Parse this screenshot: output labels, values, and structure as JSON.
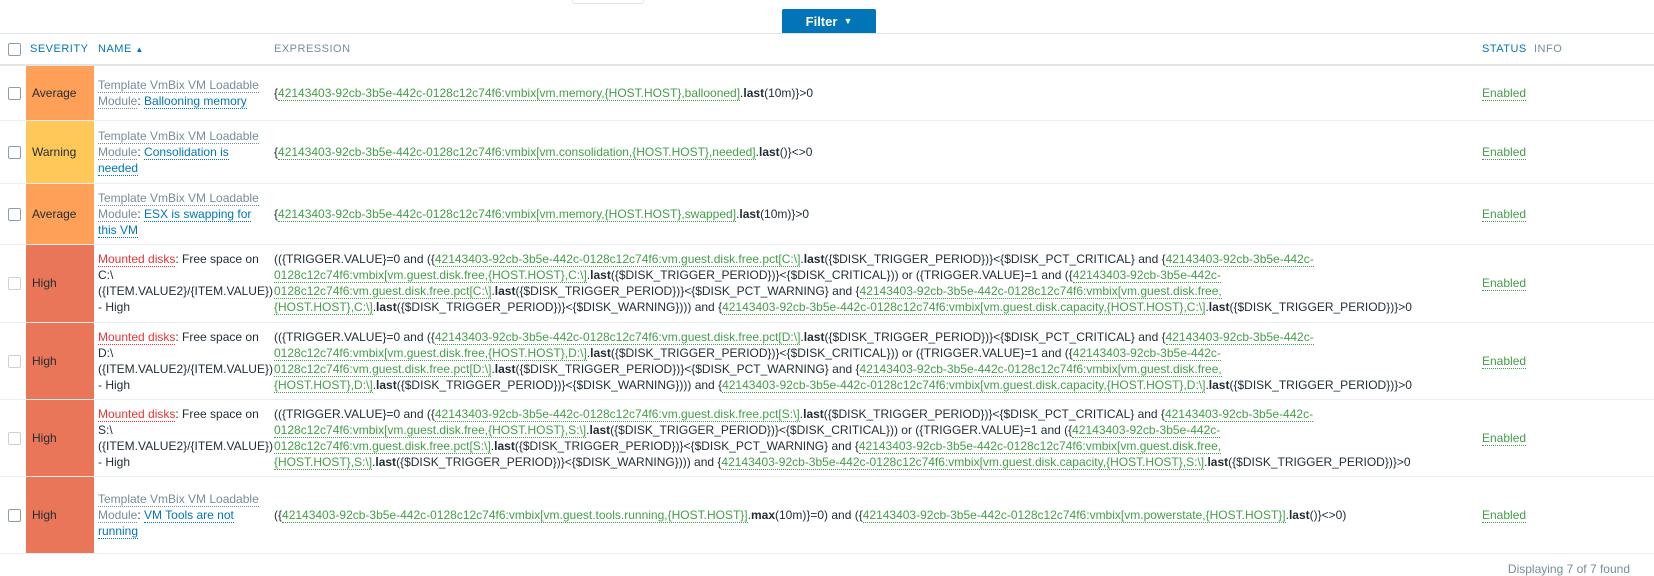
{
  "filter": {
    "label": "Filter",
    "caret": "▼"
  },
  "columns": {
    "severity": "SEVERITY",
    "name": "NAME",
    "sort_arrow": "▲",
    "expression": "EXPRESSION",
    "status": "STATUS",
    "info": "INFO"
  },
  "colors": {
    "average": "#ffa059",
    "warning": "#ffc859",
    "high": "#e97659",
    "link": "#0275b8",
    "enabled": "#429e47"
  },
  "rows": [
    {
      "severity": "Average",
      "template": "Template VmBix VM Loadable Module",
      "name": "Ballooning memory",
      "expression": [
        {
          "t": "{"
        },
        {
          "t": "42143403-92cb-3b5e-442c-0128c12c74f6:vmbix[vm.memory,{HOST.HOST},ballooned]",
          "c": "g"
        },
        {
          "t": "."
        },
        {
          "t": "last",
          "c": "f"
        },
        {
          "t": "(10m)}>0"
        }
      ],
      "status": "Enabled"
    },
    {
      "severity": "Warning",
      "template": "Template VmBix VM Loadable Module",
      "name": "Consolidation is needed",
      "expression": [
        {
          "t": "{"
        },
        {
          "t": "42143403-92cb-3b5e-442c-0128c12c74f6:vmbix[vm.consolidation,{HOST.HOST},needed]",
          "c": "g"
        },
        {
          "t": "."
        },
        {
          "t": "last",
          "c": "f"
        },
        {
          "t": "()}<>0"
        }
      ],
      "status": "Enabled"
    },
    {
      "severity": "Average",
      "template": "Template VmBix VM Loadable Module",
      "name": "ESX is swapping for this VM",
      "expression": [
        {
          "t": "{"
        },
        {
          "t": "42143403-92cb-3b5e-442c-0128c12c74f6:vmbix[vm.memory,{HOST.HOST},swapped]",
          "c": "g"
        },
        {
          "t": "."
        },
        {
          "t": "last",
          "c": "f"
        },
        {
          "t": "(10m)}>0"
        }
      ],
      "status": "Enabled"
    },
    {
      "severity": "High",
      "template": "Mounted disks",
      "name_suffix": "Free space on C:\\ ({ITEM.VALUE2}/{ITEM.VALUE}) - High",
      "expression": [
        {
          "t": "(({TRIGGER.VALUE}=0 and ({"
        },
        {
          "t": "42143403-92cb-3b5e-442c-0128c12c74f6:vm.guest.disk.free.pct[C:\\]",
          "c": "g"
        },
        {
          "t": "."
        },
        {
          "t": "last",
          "c": "f"
        },
        {
          "t": "({$DISK_TRIGGER_PERIOD})}<{$DISK_PCT_CRITICAL} and {"
        },
        {
          "t": "42143403-92cb-3b5e-442c-0128c12c74f6:vmbix[vm.guest.disk.free,{HOST.HOST},C:\\]",
          "c": "g"
        },
        {
          "t": "."
        },
        {
          "t": "last",
          "c": "f"
        },
        {
          "t": "({$DISK_TRIGGER_PERIOD})}<{$DISK_CRITICAL})) or ({TRIGGER.VALUE}=1 and ({"
        },
        {
          "t": "42143403-92cb-3b5e-442c-0128c12c74f6:vm.guest.disk.free.pct[C:\\]",
          "c": "g"
        },
        {
          "t": "."
        },
        {
          "t": "last",
          "c": "f"
        },
        {
          "t": "({$DISK_TRIGGER_PERIOD})}<{$DISK_PCT_WARNING} and {"
        },
        {
          "t": "42143403-92cb-3b5e-442c-0128c12c74f6:vmbix[vm.guest.disk.free,{HOST.HOST},C:\\]",
          "c": "g"
        },
        {
          "t": "."
        },
        {
          "t": "last",
          "c": "f"
        },
        {
          "t": "({$DISK_TRIGGER_PERIOD})}<{$DISK_WARNING}))) and {"
        },
        {
          "t": "42143403-92cb-3b5e-442c-0128c12c74f6:vmbix[vm.guest.disk.capacity,{HOST.HOST},C:\\]",
          "c": "g"
        },
        {
          "t": "."
        },
        {
          "t": "last",
          "c": "f"
        },
        {
          "t": "({$DISK_TRIGGER_PERIOD})}>0"
        }
      ],
      "status": "Enabled"
    },
    {
      "severity": "High",
      "template": "Mounted disks",
      "name_suffix": "Free space on D:\\ ({ITEM.VALUE2}/{ITEM.VALUE}) - High",
      "expression": [
        {
          "t": "(({TRIGGER.VALUE}=0 and ({"
        },
        {
          "t": "42143403-92cb-3b5e-442c-0128c12c74f6:vm.guest.disk.free.pct[D:\\]",
          "c": "g"
        },
        {
          "t": "."
        },
        {
          "t": "last",
          "c": "f"
        },
        {
          "t": "({$DISK_TRIGGER_PERIOD})}<{$DISK_PCT_CRITICAL} and {"
        },
        {
          "t": "42143403-92cb-3b5e-442c-0128c12c74f6:vmbix[vm.guest.disk.free,{HOST.HOST},D:\\]",
          "c": "g"
        },
        {
          "t": "."
        },
        {
          "t": "last",
          "c": "f"
        },
        {
          "t": "({$DISK_TRIGGER_PERIOD})}<{$DISK_CRITICAL})) or ({TRIGGER.VALUE}=1 and ({"
        },
        {
          "t": "42143403-92cb-3b5e-442c-0128c12c74f6:vm.guest.disk.free.pct[D:\\]",
          "c": "g"
        },
        {
          "t": "."
        },
        {
          "t": "last",
          "c": "f"
        },
        {
          "t": "({$DISK_TRIGGER_PERIOD})}<{$DISK_PCT_WARNING} and {"
        },
        {
          "t": "42143403-92cb-3b5e-442c-0128c12c74f6:vmbix[vm.guest.disk.free,{HOST.HOST},D:\\]",
          "c": "g"
        },
        {
          "t": "."
        },
        {
          "t": "last",
          "c": "f"
        },
        {
          "t": "({$DISK_TRIGGER_PERIOD})}<{$DISK_WARNING}))) and {"
        },
        {
          "t": "42143403-92cb-3b5e-442c-0128c12c74f6:vmbix[vm.guest.disk.capacity,{HOST.HOST},D:\\]",
          "c": "g"
        },
        {
          "t": "."
        },
        {
          "t": "last",
          "c": "f"
        },
        {
          "t": "({$DISK_TRIGGER_PERIOD})}>0"
        }
      ],
      "status": "Enabled"
    },
    {
      "severity": "High",
      "template": "Mounted disks",
      "name_suffix": "Free space on S:\\ ({ITEM.VALUE2}/{ITEM.VALUE}) - High",
      "expression": [
        {
          "t": "(({TRIGGER.VALUE}=0 and ({"
        },
        {
          "t": "42143403-92cb-3b5e-442c-0128c12c74f6:vm.guest.disk.free.pct[S:\\]",
          "c": "g"
        },
        {
          "t": "."
        },
        {
          "t": "last",
          "c": "f"
        },
        {
          "t": "({$DISK_TRIGGER_PERIOD})}<{$DISK_PCT_CRITICAL} and {"
        },
        {
          "t": "42143403-92cb-3b5e-442c-0128c12c74f6:vmbix[vm.guest.disk.free,{HOST.HOST},S:\\]",
          "c": "g"
        },
        {
          "t": "."
        },
        {
          "t": "last",
          "c": "f"
        },
        {
          "t": "({$DISK_TRIGGER_PERIOD})}<{$DISK_CRITICAL})) or ({TRIGGER.VALUE}=1 and ({"
        },
        {
          "t": "42143403-92cb-3b5e-442c-0128c12c74f6:vm.guest.disk.free.pct[S:\\]",
          "c": "g"
        },
        {
          "t": "."
        },
        {
          "t": "last",
          "c": "f"
        },
        {
          "t": "({$DISK_TRIGGER_PERIOD})}<{$DISK_PCT_WARNING} and {"
        },
        {
          "t": "42143403-92cb-3b5e-442c-0128c12c74f6:vmbix[vm.guest.disk.free,{HOST.HOST},S:\\]",
          "c": "g"
        },
        {
          "t": "."
        },
        {
          "t": "last",
          "c": "f"
        },
        {
          "t": "({$DISK_TRIGGER_PERIOD})}<{$DISK_WARNING}))) and {"
        },
        {
          "t": "42143403-92cb-3b5e-442c-0128c12c74f6:vmbix[vm.guest.disk.capacity,{HOST.HOST},S:\\]",
          "c": "g"
        },
        {
          "t": "."
        },
        {
          "t": "last",
          "c": "f"
        },
        {
          "t": "({$DISK_TRIGGER_PERIOD})}>0"
        }
      ],
      "status": "Enabled"
    },
    {
      "severity": "High",
      "template": "Template VmBix VM Loadable Module",
      "name": "VM Tools are not running",
      "expression": [
        {
          "t": "({"
        },
        {
          "t": "42143403-92cb-3b5e-442c-0128c12c74f6:vmbix[vm.guest.tools.running,{HOST.HOST}]",
          "c": "g"
        },
        {
          "t": "."
        },
        {
          "t": "max",
          "c": "f"
        },
        {
          "t": "(10m)}=0) and ({"
        },
        {
          "t": "42143403-92cb-3b5e-442c-0128c12c74f6:vmbix[vm.powerstate,{HOST.HOST}]",
          "c": "g"
        },
        {
          "t": "."
        },
        {
          "t": "last",
          "c": "f"
        },
        {
          "t": "()}<>0)"
        }
      ],
      "status": "Enabled"
    }
  ],
  "footer": {
    "text": "Displaying 7 of 7 found"
  }
}
